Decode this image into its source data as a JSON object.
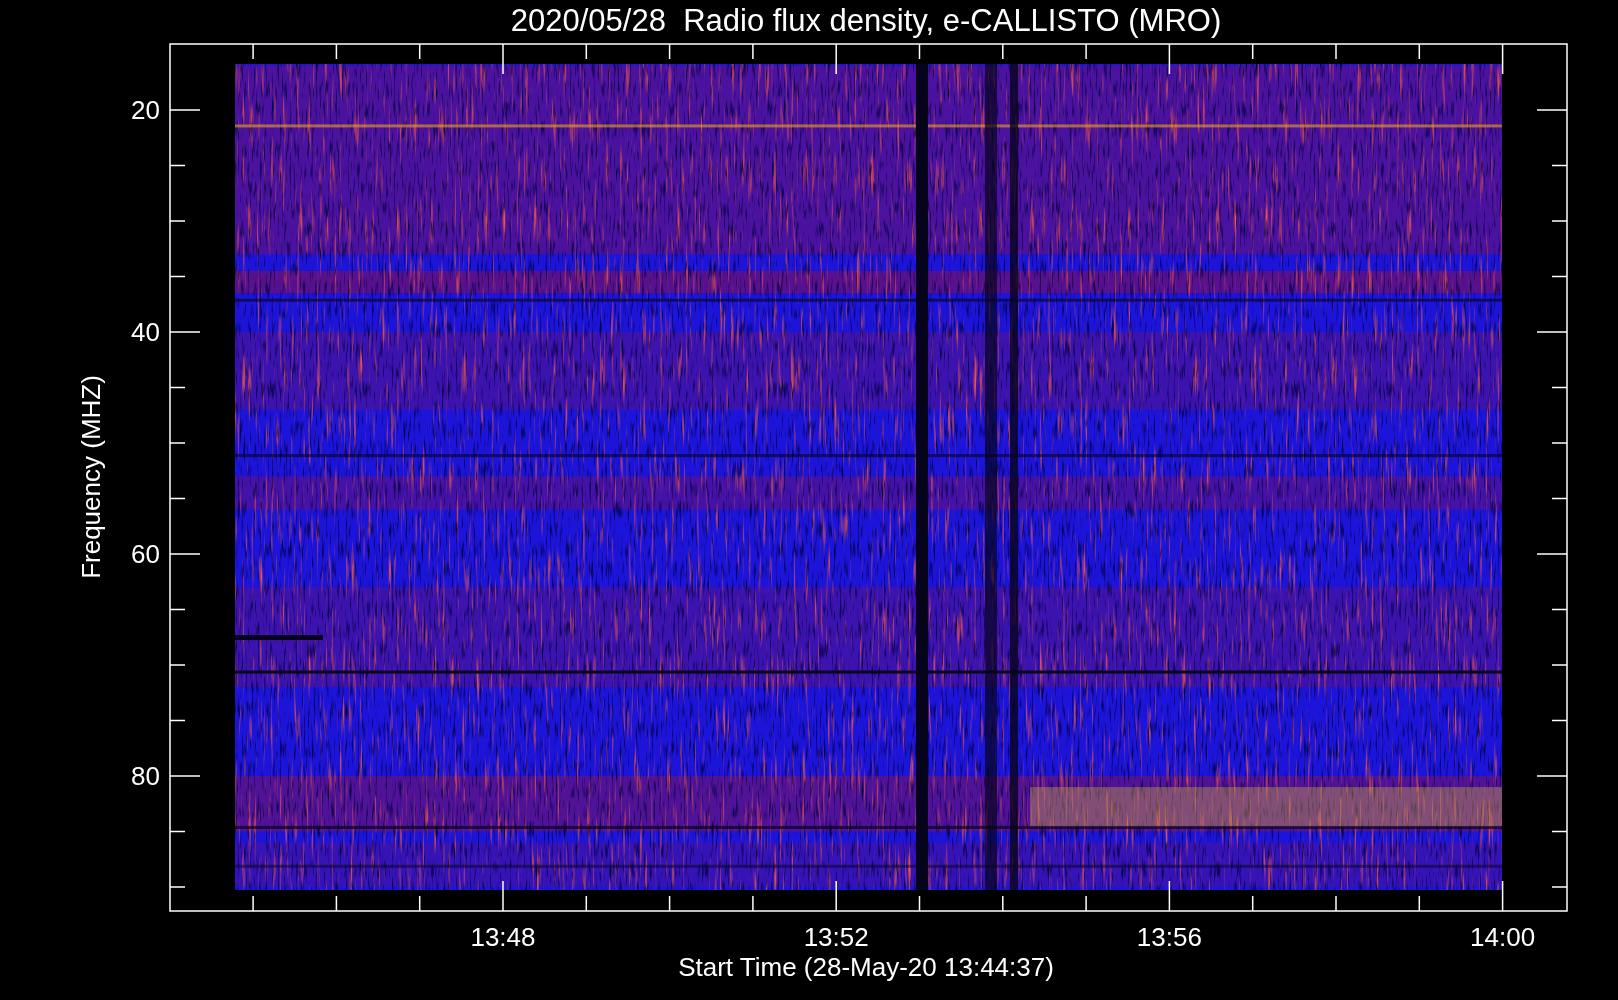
{
  "title": "2020/05/28  Radio flux density, e-CALLISTO (MRO)",
  "ylabel": "Frequency (MHZ)",
  "xlabel": "Start Time (28-May-20 13:44:37)",
  "yticks": [
    "20",
    "40",
    "60",
    "80"
  ],
  "xticks": [
    "13:48",
    "13:52",
    "13:56",
    "14:00"
  ]
}
